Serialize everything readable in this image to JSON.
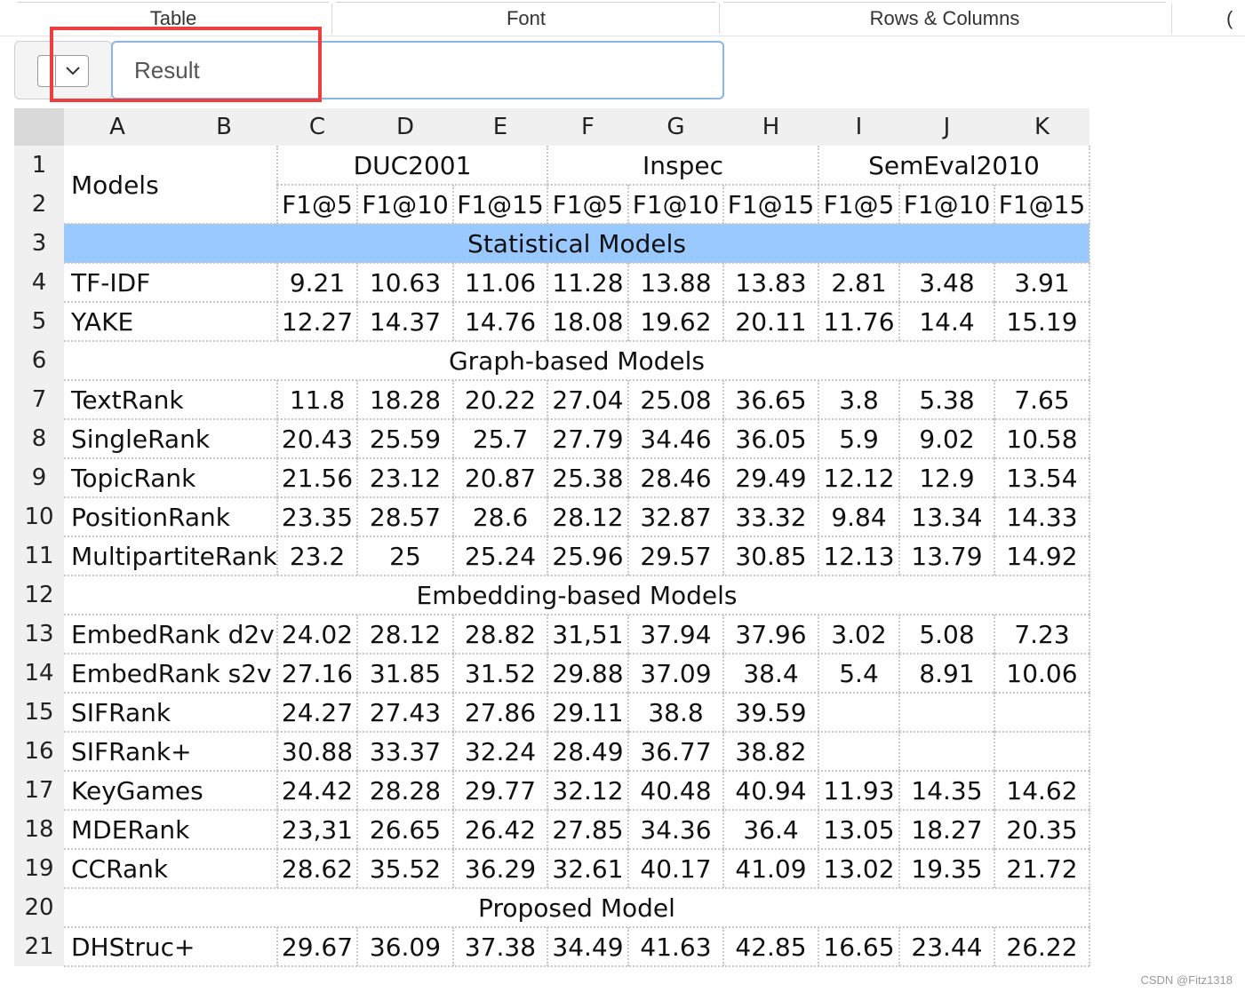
{
  "ribbon": {
    "groups": [
      "Table",
      "Font",
      "Rows & Columns",
      "("
    ]
  },
  "formula_bar": {
    "name_box": "",
    "value": "Result"
  },
  "columns": [
    "A",
    "B",
    "C",
    "D",
    "E",
    "F",
    "G",
    "H",
    "I",
    "J",
    "K"
  ],
  "rows": [
    "1",
    "2",
    "3",
    "4",
    "5",
    "6",
    "7",
    "8",
    "9",
    "10",
    "11",
    "12",
    "13",
    "14",
    "15",
    "16",
    "17",
    "18",
    "19",
    "20",
    "21"
  ],
  "table": {
    "models_header": "Models",
    "datasets": [
      "DUC2001",
      "Inspec",
      "SemEval2010"
    ],
    "metrics": [
      "F1@5",
      "F1@10",
      "F1@15",
      "F1@5",
      "F1@10",
      "F1@15",
      "F1@5",
      "F1@10",
      "F1@15"
    ],
    "sections": {
      "statistical": "Statistical Models",
      "graph": "Graph-based Models",
      "embedding": "Embedding-based Models",
      "proposed": "Proposed Model"
    },
    "rows": [
      {
        "row": 4,
        "model": "TF-IDF",
        "values": [
          "9.21",
          "10.63",
          "11.06",
          "11.28",
          "13.88",
          "13.83",
          "2.81",
          "3.48",
          "3.91"
        ]
      },
      {
        "row": 5,
        "model": "YAKE",
        "values": [
          "12.27",
          "14.37",
          "14.76",
          "18.08",
          "19.62",
          "20.11",
          "11.76",
          "14.4",
          "15.19"
        ]
      },
      {
        "row": 7,
        "model": "TextRank",
        "values": [
          "11.8",
          "18.28",
          "20.22",
          "27.04",
          "25.08",
          "36.65",
          "3.8",
          "5.38",
          "7.65"
        ]
      },
      {
        "row": 8,
        "model": "SingleRank",
        "values": [
          "20.43",
          "25.59",
          "25.7",
          "27.79",
          "34.46",
          "36.05",
          "5.9",
          "9.02",
          "10.58"
        ]
      },
      {
        "row": 9,
        "model": "TopicRank",
        "values": [
          "21.56",
          "23.12",
          "20.87",
          "25.38",
          "28.46",
          "29.49",
          "12.12",
          "12.9",
          "13.54"
        ]
      },
      {
        "row": 10,
        "model": "PositionRank",
        "values": [
          "23.35",
          "28.57",
          "28.6",
          "28.12",
          "32.87",
          "33.32",
          "9.84",
          "13.34",
          "14.33"
        ]
      },
      {
        "row": 11,
        "model": "MultipartiteRank",
        "values": [
          "23.2",
          "25",
          "25.24",
          "25.96",
          "29.57",
          "30.85",
          "12.13",
          "13.79",
          "14.92"
        ]
      },
      {
        "row": 13,
        "model": "EmbedRank d2v",
        "values": [
          "24.02",
          "28.12",
          "28.82",
          "31,51",
          "37.94",
          "37.96",
          "3.02",
          "5.08",
          "7.23"
        ]
      },
      {
        "row": 14,
        "model": "EmbedRank s2v",
        "values": [
          "27.16",
          "31.85",
          "31.52",
          "29.88",
          "37.09",
          "38.4",
          "5.4",
          "8.91",
          "10.06"
        ]
      },
      {
        "row": 15,
        "model": "SIFRank",
        "values": [
          "24.27",
          "27.43",
          "27.86",
          "29.11",
          "38.8",
          "39.59",
          "",
          "",
          ""
        ]
      },
      {
        "row": 16,
        "model": "SIFRank+",
        "values": [
          "30.88",
          "33.37",
          "32.24",
          "28.49",
          "36.77",
          "38.82",
          "",
          "",
          ""
        ]
      },
      {
        "row": 17,
        "model": "KeyGames",
        "values": [
          "24.42",
          "28.28",
          "29.77",
          "32.12",
          "40.48",
          "40.94",
          "11.93",
          "14.35",
          "14.62"
        ]
      },
      {
        "row": 18,
        "model": "MDERank",
        "values": [
          "23,31",
          "26.65",
          "26.42",
          "27.85",
          "34.36",
          "36.4",
          "13.05",
          "18.27",
          "20.35"
        ]
      },
      {
        "row": 19,
        "model": "CCRank",
        "values": [
          "28.62",
          "35.52",
          "36.29",
          "32.61",
          "40.17",
          "41.09",
          "13.02",
          "19.35",
          "21.72"
        ]
      },
      {
        "row": 21,
        "model": "DHStruc+",
        "values": [
          "29.67",
          "36.09",
          "37.38",
          "34.49",
          "41.63",
          "42.85",
          "16.65",
          "23.44",
          "26.22"
        ]
      }
    ]
  },
  "watermark": "CSDN @Fitz1318",
  "colors": {
    "highlight": "#99c9ff",
    "annotation_box": "#ef3e3e",
    "focus_border": "#8ab6e6"
  }
}
